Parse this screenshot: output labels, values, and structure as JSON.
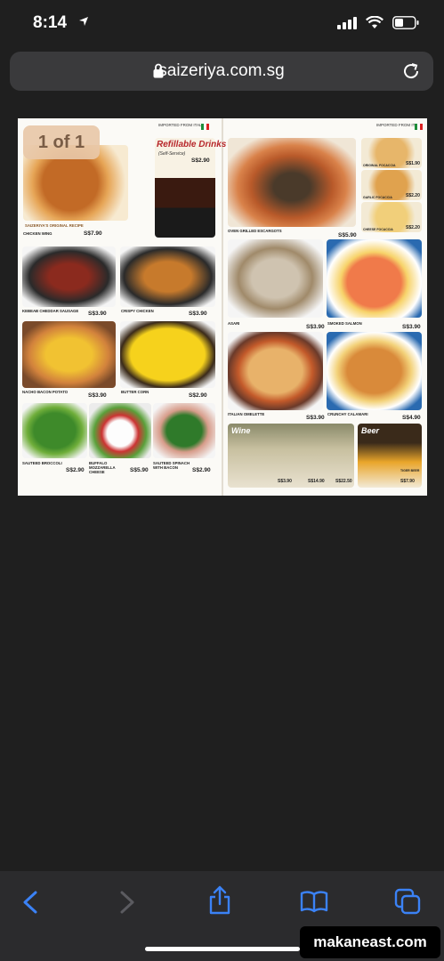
{
  "status_bar": {
    "time": "8:14"
  },
  "address_bar": {
    "url": "saizeriya.com.sg"
  },
  "viewer": {
    "page_indicator": "1 of 1"
  },
  "menu": {
    "header_left": "IMPORTED FROM ITALY",
    "header_right": "IMPORTED FROM ITALY",
    "drinks": {
      "title": "Refillable Drinks",
      "subtitle": "(Self-Service)",
      "price": "S$2.90"
    },
    "items": [
      {
        "name": "CHICKEN WING",
        "note": "SAIZERIYA'S ORIGINAL RECIPE",
        "price": "S$7.90"
      },
      {
        "name": "KEBEAB CHEDDAR SAUSAGE",
        "price": "S$3.90"
      },
      {
        "name": "CRISPY CHICKEN",
        "price": "S$3.90"
      },
      {
        "name": "NACHO BACON POTATO",
        "price": "S$3.90"
      },
      {
        "name": "BUTTER CORN",
        "price": "S$2.90"
      },
      {
        "name": "SAUTEED BROCCOLI",
        "price": "S$2.90"
      },
      {
        "name": "BUFFALO MOZZARELLA CHEESE",
        "price": "S$5.90"
      },
      {
        "name": "SAUTEED SPINACH WITH BACON",
        "price": "S$2.90"
      },
      {
        "name": "OVEN GRILLED ESCARGOTS",
        "price": "S$5.90"
      },
      {
        "name": "ORIGINAL FOCACCIA",
        "price": "S$1.90"
      },
      {
        "name": "GARLIC FOCACCIA",
        "price": "S$2.20"
      },
      {
        "name": "CHEESE FOCACCIA",
        "price": "S$2.20"
      },
      {
        "name": "ASARI",
        "price": "S$3.90"
      },
      {
        "name": "SMOKED SALMON",
        "price": "S$3.90"
      },
      {
        "name": "ITALIAN OMELETTE",
        "price": "S$3.90"
      },
      {
        "name": "CRUNCHY CALAMARI",
        "price": "S$4.90"
      }
    ],
    "wine": {
      "label": "Wine",
      "prices": [
        "S$3.90",
        "S$14.90",
        "S$22.50"
      ]
    },
    "beer": {
      "label": "Beer",
      "name": "TIGER BEER",
      "price": "S$7.90"
    }
  },
  "toolbar": {},
  "watermark": "makaneast.com"
}
